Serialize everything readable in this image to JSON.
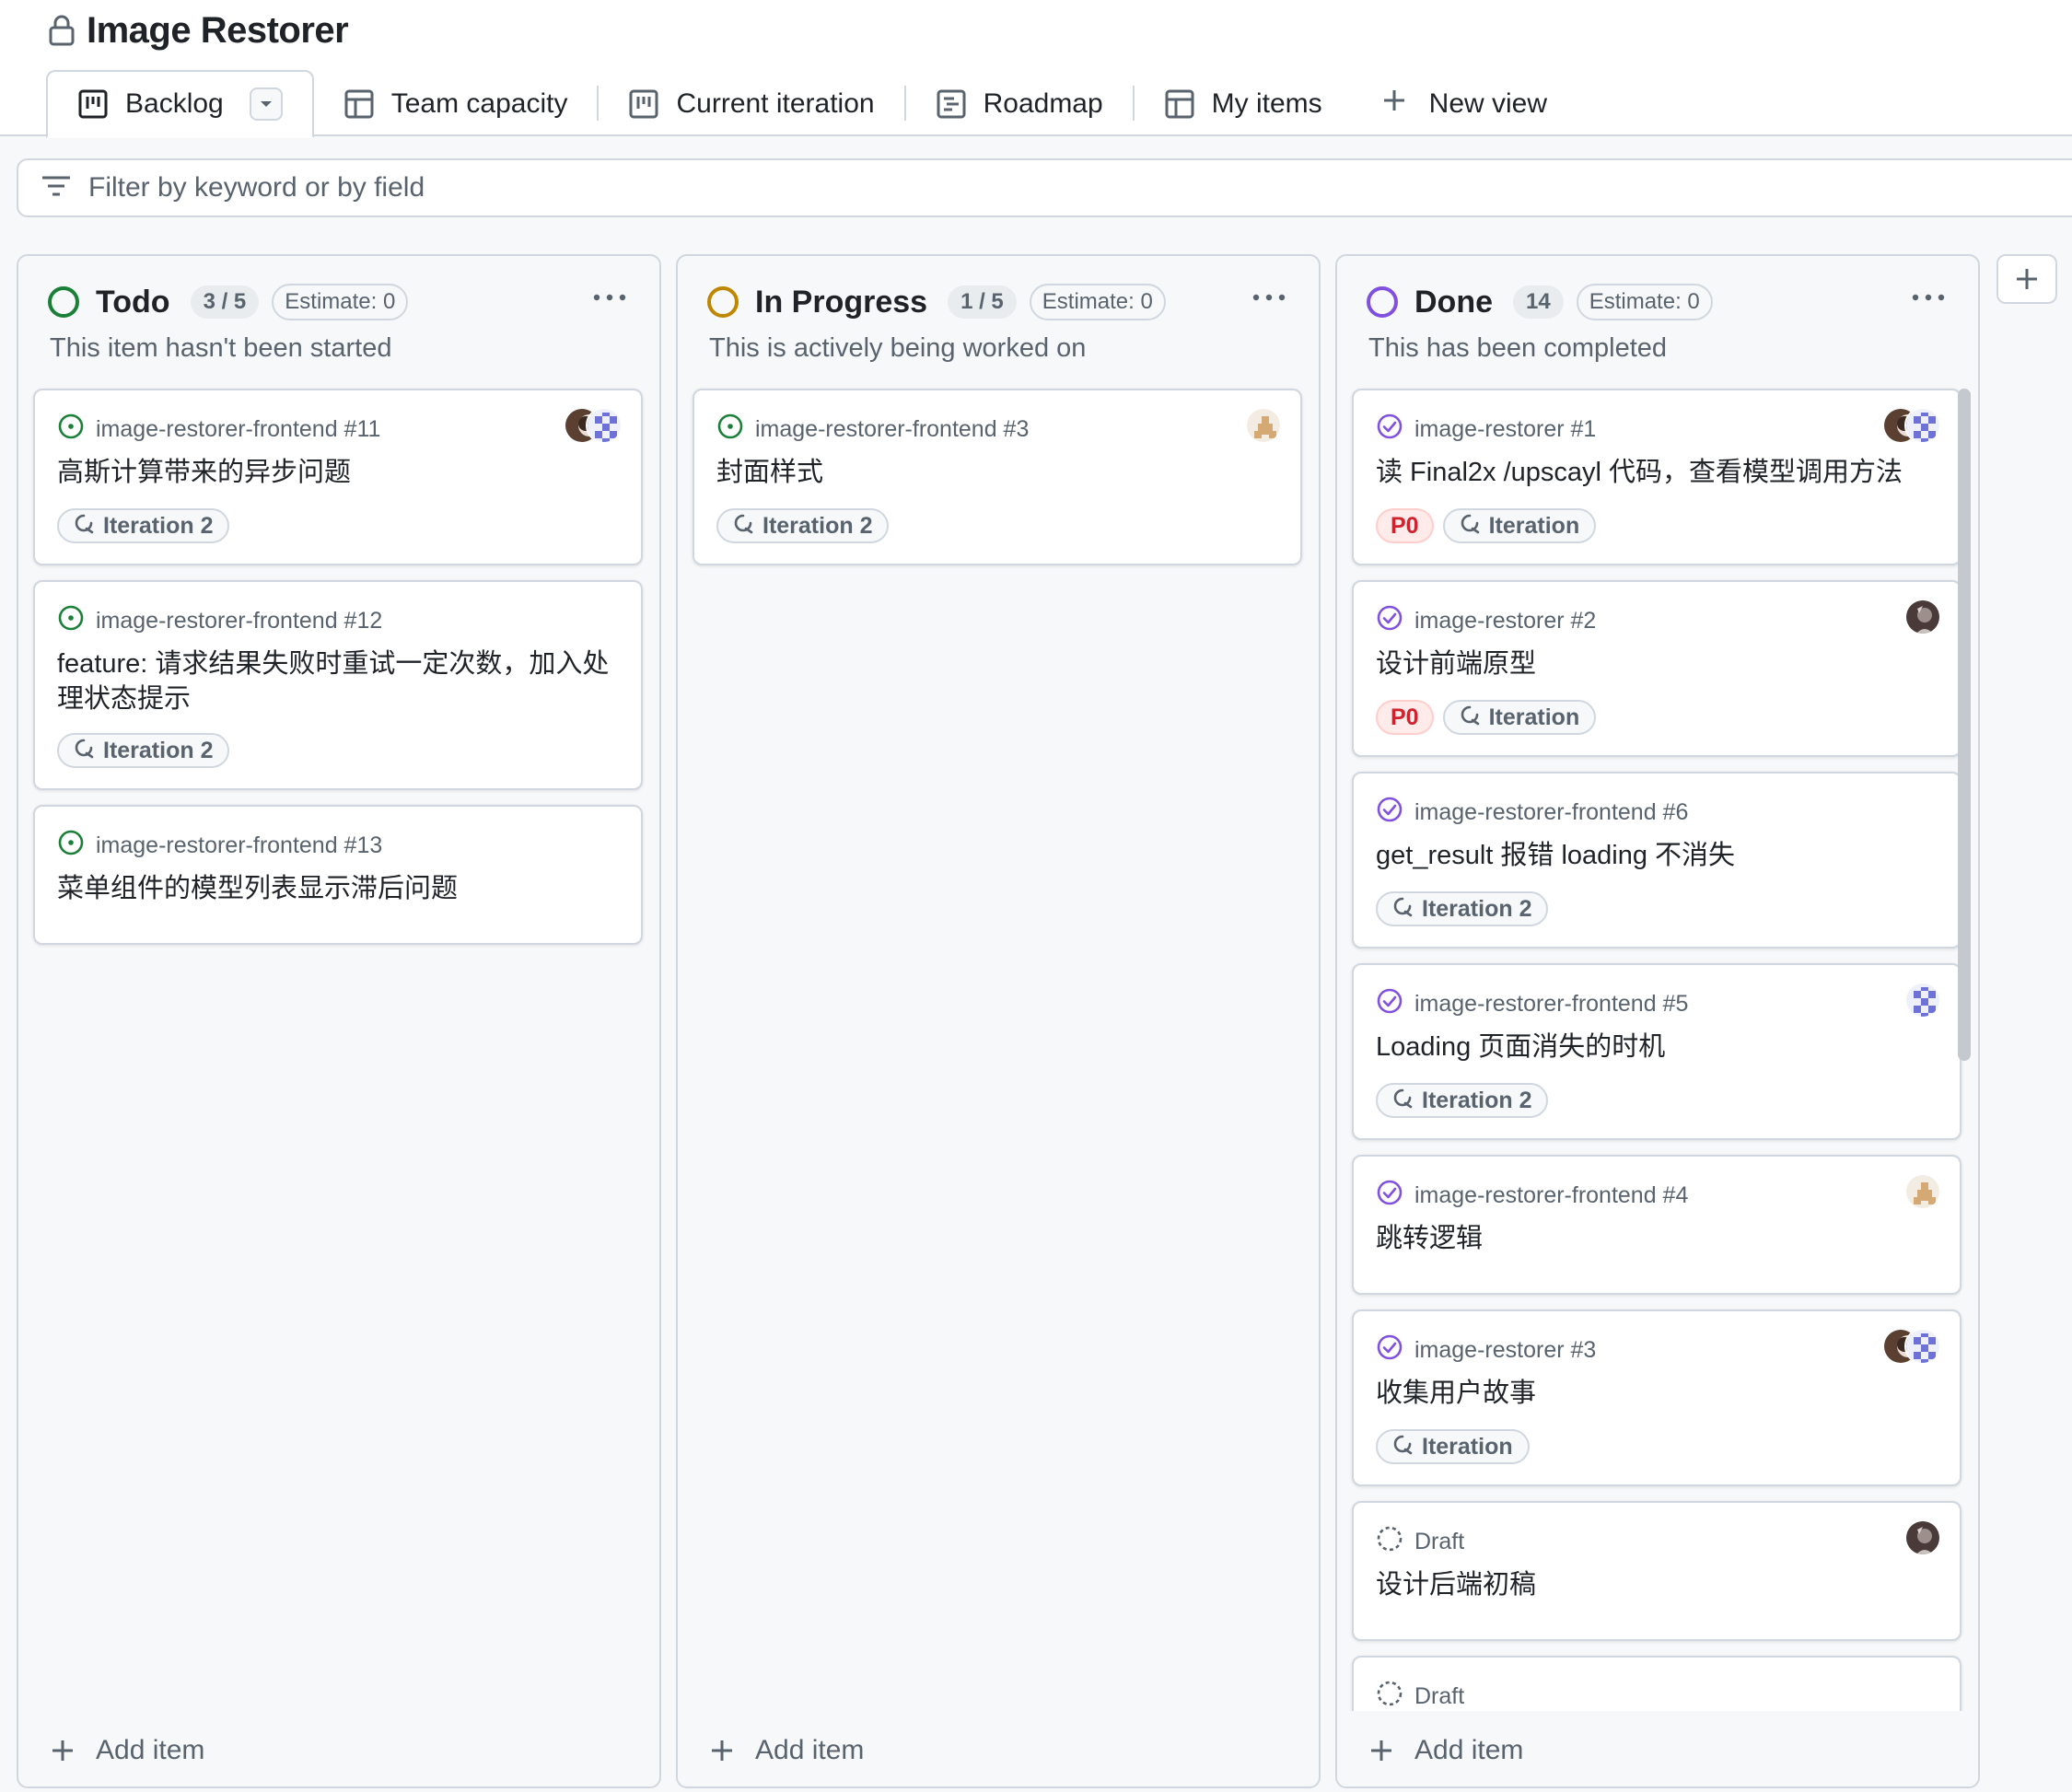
{
  "project": {
    "title": "Image Restorer"
  },
  "tabs": [
    {
      "label": "Backlog",
      "icon": "board-icon"
    },
    {
      "label": "Team capacity",
      "icon": "table-icon"
    },
    {
      "label": "Current iteration",
      "icon": "board-icon"
    },
    {
      "label": "Roadmap",
      "icon": "roadmap-icon"
    },
    {
      "label": "My items",
      "icon": "table-icon"
    }
  ],
  "new_view_label": "New view",
  "filter": {
    "placeholder": "Filter by keyword or by field"
  },
  "colors": {
    "todo": "#1a7f37",
    "in_progress": "#bf8700",
    "open_issue": "#1a7f37",
    "done": "#8250df",
    "draft": "#59636e",
    "p0_text": "#cf222e"
  },
  "columns": [
    {
      "name": "Todo",
      "count": "3 / 5",
      "estimate": "Estimate: 0",
      "description": "This item hasn't been started",
      "add_label": "Add item",
      "cards": [
        {
          "ref": "image-restorer-frontend #11",
          "title": "高斯计算带来的异步问题",
          "labels": [
            "Iteration 2"
          ],
          "priority": "",
          "avatars": [
            "avatar-dark",
            "avatar-pixel"
          ],
          "state": "open"
        },
        {
          "ref": "image-restorer-frontend #12",
          "title": "feature: 请求结果失败时重试一定次数，加入处理状态提示",
          "labels": [
            "Iteration 2"
          ],
          "priority": "",
          "avatars": [],
          "state": "open"
        },
        {
          "ref": "image-restorer-frontend #13",
          "title": "菜单组件的模型列表显示滞后问题",
          "labels": [],
          "priority": "",
          "avatars": [],
          "state": "open"
        }
      ]
    },
    {
      "name": "In Progress",
      "count": "1 / 5",
      "estimate": "Estimate: 0",
      "description": "This is actively being worked on",
      "add_label": "Add item",
      "cards": [
        {
          "ref": "image-restorer-frontend #3",
          "title": "封面样式",
          "labels": [
            "Iteration 2"
          ],
          "priority": "",
          "avatars": [
            "avatar-tan"
          ],
          "state": "open"
        }
      ]
    },
    {
      "name": "Done",
      "count": "14",
      "estimate": "Estimate: 0",
      "description": "This has been completed",
      "add_label": "Add item",
      "cards": [
        {
          "ref": "image-restorer #1",
          "title": "读 Final2x /upscayl 代码，查看模型调用方法",
          "labels": [
            "Iteration"
          ],
          "priority": "P0",
          "avatars": [
            "avatar-dark",
            "avatar-pixel"
          ],
          "state": "done"
        },
        {
          "ref": "image-restorer #2",
          "title": "设计前端原型",
          "labels": [
            "Iteration"
          ],
          "priority": "P0",
          "avatars": [
            "avatar-photo"
          ],
          "state": "done"
        },
        {
          "ref": "image-restorer-frontend #6",
          "title": "get_result 报错 loading 不消失",
          "labels": [
            "Iteration 2"
          ],
          "priority": "",
          "avatars": [],
          "state": "done"
        },
        {
          "ref": "image-restorer-frontend #5",
          "title": "Loading 页面消失的时机",
          "labels": [
            "Iteration 2"
          ],
          "priority": "",
          "avatars": [
            "avatar-pixel"
          ],
          "state": "done"
        },
        {
          "ref": "image-restorer-frontend #4",
          "title": "跳转逻辑",
          "labels": [],
          "priority": "",
          "avatars": [
            "avatar-tan"
          ],
          "state": "done"
        },
        {
          "ref": "image-restorer #3",
          "title": "收集用户故事",
          "labels": [
            "Iteration"
          ],
          "priority": "",
          "avatars": [
            "avatar-dark",
            "avatar-pixel"
          ],
          "state": "done"
        },
        {
          "ref": "Draft",
          "title": "设计后端初稿",
          "labels": [],
          "priority": "",
          "avatars": [
            "avatar-photo"
          ],
          "state": "draft"
        },
        {
          "ref": "Draft",
          "title": "",
          "labels": [],
          "priority": "",
          "avatars": [],
          "state": "draft"
        }
      ]
    }
  ]
}
